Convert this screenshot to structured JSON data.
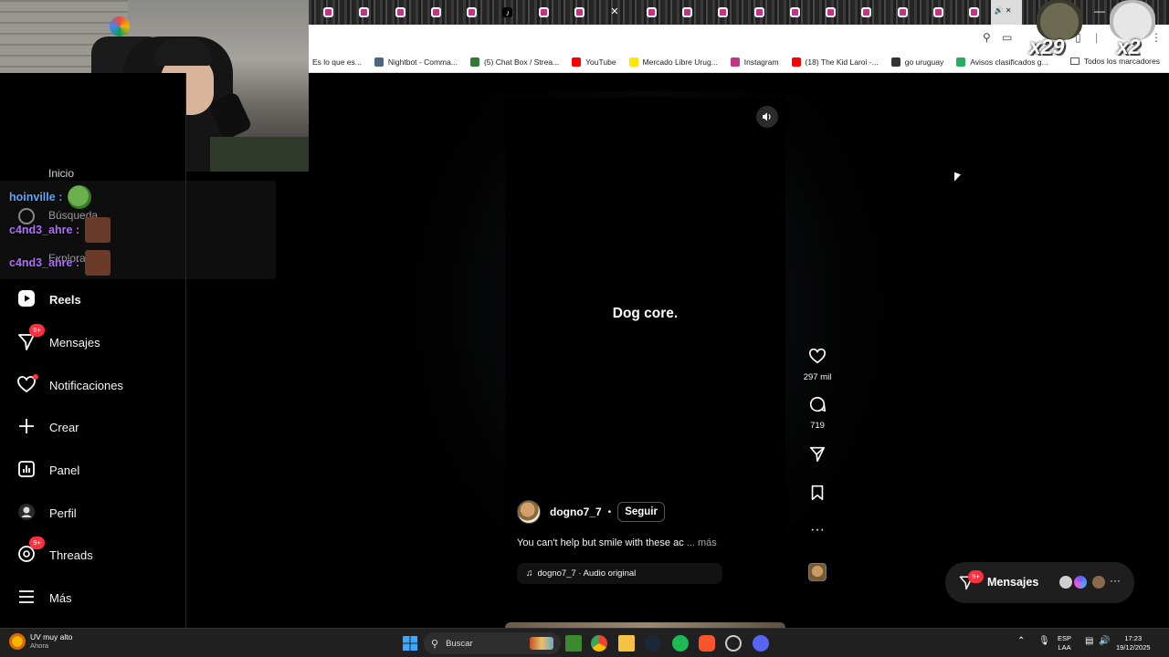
{
  "browser": {
    "tab_count": 19,
    "bookmarks": [
      {
        "label": "Es lo que es...",
        "color": "#e53935"
      },
      {
        "label": "Nightbot - Comma...",
        "color": "#4b6584"
      },
      {
        "label": "(5) Chat Box / Strea...",
        "color": "#2e7d32"
      },
      {
        "label": "YouTube",
        "color": "#ff0000"
      },
      {
        "label": "Mercado Libre Urug...",
        "color": "#ffe600"
      },
      {
        "label": "Instagram",
        "color": "#c13584"
      },
      {
        "label": "(18) The Kid Laroi -...",
        "color": "#ff0000"
      },
      {
        "label": "go uruguay",
        "color": "#333333"
      },
      {
        "label": "Avisos clasificados g...",
        "color": "#27ae60"
      }
    ],
    "all_bookmarks": "Todos los marcadores"
  },
  "chat": [
    {
      "user": "hoinville",
      "color": "#5aa9ff",
      "sep": ":"
    },
    {
      "user": "c4nd3_ahre",
      "color": "#b06cff",
      "sep": ":"
    },
    {
      "user": "c4nd3_ahre",
      "color": "#b06cff",
      "sep": ":"
    }
  ],
  "sidebar": {
    "ghost_items": [
      "Inicio",
      "Búsqueda",
      "Explorar"
    ],
    "items": [
      {
        "label": "Reels",
        "icon": "reels-icon"
      },
      {
        "label": "Mensajes",
        "icon": "messages-icon",
        "badge": "9+"
      },
      {
        "label": "Notificaciones",
        "icon": "heart-icon"
      },
      {
        "label": "Crear",
        "icon": "plus-icon"
      },
      {
        "label": "Panel",
        "icon": "dashboard-icon"
      },
      {
        "label": "Perfil",
        "icon": "profile-icon"
      },
      {
        "label": "Threads",
        "icon": "threads-icon",
        "badge": "9+"
      },
      {
        "label": "Más",
        "icon": "menu-icon"
      }
    ]
  },
  "reel": {
    "caption": "Dog core.",
    "author": "dogno7_7",
    "separator": "•",
    "follow_label": "Seguir",
    "description": "You can't help but smile with these ac",
    "more_label": "... más",
    "audio": "dogno7_7 · Audio original"
  },
  "actions": {
    "likes": "297 mil",
    "comments": "719"
  },
  "messages_pill": {
    "label": "Mensajes",
    "badge": "9+"
  },
  "stickers": [
    {
      "label": "x29"
    },
    {
      "label": "x2"
    }
  ],
  "taskbar": {
    "weather_title": "UV muy alto",
    "weather_sub": "Ahora",
    "search": "Buscar",
    "lang_1": "ESP",
    "lang_2": "LAA",
    "time": "17:23",
    "date": "19/12/2025"
  },
  "colors": {
    "badge": "#ff3040",
    "instagram": "#c13584"
  }
}
